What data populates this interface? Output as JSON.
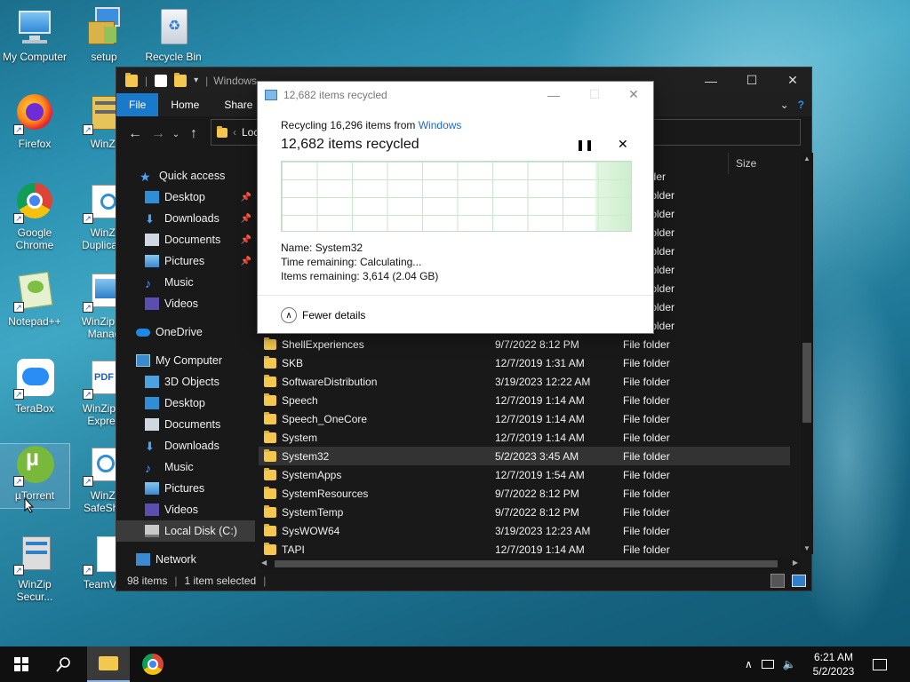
{
  "desktop": {
    "icons": [
      {
        "label": "My Computer"
      },
      {
        "label": "setup"
      },
      {
        "label": "Recycle Bin"
      },
      {
        "label": "Firefox"
      },
      {
        "label": "WinZi"
      },
      {
        "label": "Google Chrome"
      },
      {
        "label": "WinZi Duplicate"
      },
      {
        "label": "Notepad++"
      },
      {
        "label": "WinZip In Manag"
      },
      {
        "label": "TeraBox"
      },
      {
        "label": "WinZip P Expres"
      },
      {
        "label": "µTorrent"
      },
      {
        "label": "WinZi SafeSha"
      },
      {
        "label": "WinZip Secur..."
      },
      {
        "label": "TeamVie"
      }
    ]
  },
  "explorer": {
    "title": "Windows",
    "ribbon_tabs": [
      "File",
      "Home",
      "Share"
    ],
    "address": "Loc",
    "size_column": "Size",
    "sidebar": [
      {
        "label": "Quick access"
      },
      {
        "label": "Desktop"
      },
      {
        "label": "Downloads"
      },
      {
        "label": "Documents"
      },
      {
        "label": "Pictures"
      },
      {
        "label": "Music"
      },
      {
        "label": "Videos"
      },
      {
        "label": "OneDrive"
      },
      {
        "label": "My Computer"
      },
      {
        "label": "3D Objects"
      },
      {
        "label": "Desktop"
      },
      {
        "label": "Documents"
      },
      {
        "label": "Downloads"
      },
      {
        "label": "Music"
      },
      {
        "label": "Pictures"
      },
      {
        "label": "Videos"
      },
      {
        "label": "Local Disk (C:)"
      },
      {
        "label": "Network"
      }
    ],
    "hidden_type_fragments": [
      "lder",
      "folder",
      "folder",
      "folder",
      "folder",
      "folder",
      "folder",
      "folder",
      "folder"
    ],
    "files": [
      {
        "name": "ShellExperiences",
        "date": "9/7/2022 8:12 PM",
        "type": "File folder"
      },
      {
        "name": "SKB",
        "date": "12/7/2019 1:31 AM",
        "type": "File folder"
      },
      {
        "name": "SoftwareDistribution",
        "date": "3/19/2023 12:22 AM",
        "type": "File folder"
      },
      {
        "name": "Speech",
        "date": "12/7/2019 1:14 AM",
        "type": "File folder"
      },
      {
        "name": "Speech_OneCore",
        "date": "12/7/2019 1:14 AM",
        "type": "File folder"
      },
      {
        "name": "System",
        "date": "12/7/2019 1:14 AM",
        "type": "File folder"
      },
      {
        "name": "System32",
        "date": "5/2/2023 3:45 AM",
        "type": "File folder"
      },
      {
        "name": "SystemApps",
        "date": "12/7/2019 1:54 AM",
        "type": "File folder"
      },
      {
        "name": "SystemResources",
        "date": "9/7/2022 8:12 PM",
        "type": "File folder"
      },
      {
        "name": "SystemTemp",
        "date": "9/7/2022 8:12 PM",
        "type": "File folder"
      },
      {
        "name": "SysWOW64",
        "date": "3/19/2023 12:23 AM",
        "type": "File folder"
      },
      {
        "name": "TAPI",
        "date": "12/7/2019 1:14 AM",
        "type": "File folder"
      }
    ],
    "status_count": "98 items",
    "status_selected": "1 item selected"
  },
  "dialog": {
    "title": "12,682 items recycled",
    "line1_prefix": "Recycling 16,296 items from ",
    "line1_link": "Windows",
    "heading": "12,682 items recycled",
    "name_label": "Name:",
    "name_value": "System32",
    "time_label": "Time remaining:",
    "time_value": "Calculating...",
    "items_label": "Items remaining:",
    "items_value": "3,614 (2.04 GB)",
    "fewer_details": "Fewer details",
    "progress": 0.78
  },
  "taskbar": {
    "time": "6:21 AM",
    "date": "5/2/2023"
  },
  "colors": {
    "accent": "#1979ca",
    "link": "#1a6ac9",
    "folder": "#f4c84e"
  }
}
